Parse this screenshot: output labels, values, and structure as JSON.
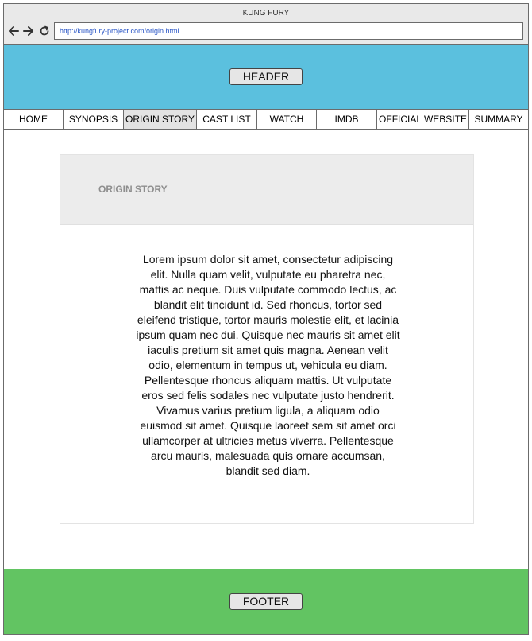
{
  "browser": {
    "window_title": "KUNG FURY",
    "url": "http://kungfury-project.com/origin.html",
    "back_icon": "arrow-left-icon",
    "forward_icon": "arrow-right-icon",
    "reload_icon": "reload-icon"
  },
  "header": {
    "label": "HEADER",
    "color": "#5bc0de"
  },
  "menu": {
    "items": [
      {
        "label": "HOME",
        "active": false
      },
      {
        "label": "SYNOPSIS",
        "active": false
      },
      {
        "label": "ORIGIN STORY",
        "active": true
      },
      {
        "label": "CAST LIST",
        "active": false
      },
      {
        "label": "WATCH",
        "active": false
      },
      {
        "label": "IMDB",
        "active": false
      },
      {
        "label": "OFFICIAL WEBSITE",
        "active": false
      },
      {
        "label": "SUMMARY",
        "active": false
      }
    ]
  },
  "card": {
    "title": "ORIGIN STORY",
    "body": "Lorem ipsum dolor sit amet, consectetur adipiscing elit. Nulla quam velit, vulputate eu pharetra nec, mattis ac neque. Duis vulputate commodo lectus, ac blandit elit tincidunt id. Sed rhoncus, tortor sed eleifend tristique, tortor mauris molestie elit, et lacinia ipsum quam nec dui. Quisque nec mauris sit amet elit iaculis pretium sit amet quis magna. Aenean velit odio, elementum in tempus ut, vehicula eu diam. Pellentesque rhoncus aliquam mattis. Ut vulputate eros sed felis sodales nec vulputate justo hendrerit. Vivamus varius pretium ligula, a aliquam odio euismod sit amet. Quisque laoreet sem sit amet orci ullamcorper at ultricies metus viverra. Pellentesque arcu mauris, malesuada quis ornare accumsan, blandit sed diam."
  },
  "footer": {
    "label": "FOOTER",
    "color": "#62c462"
  }
}
